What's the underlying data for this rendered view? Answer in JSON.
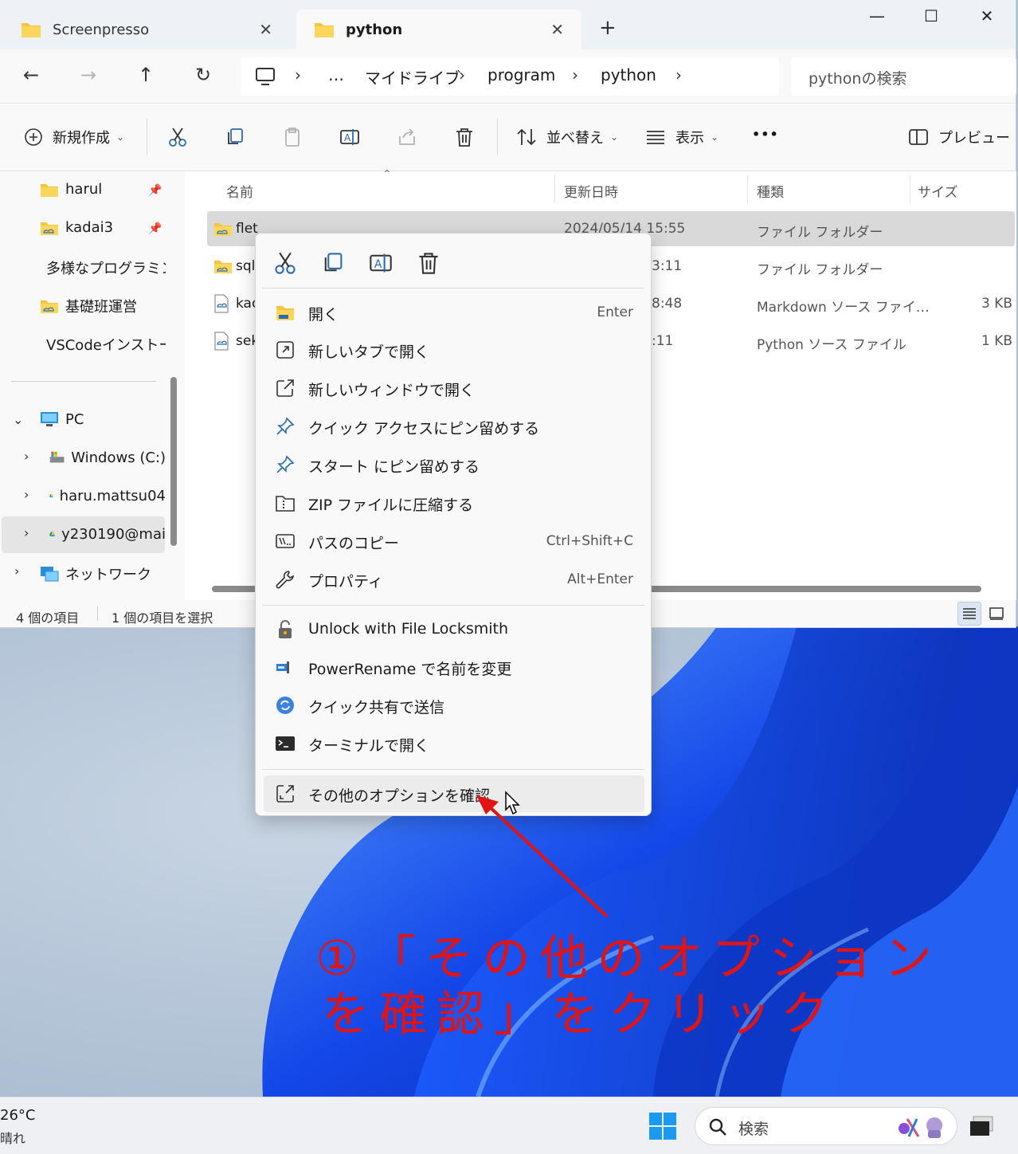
{
  "tabs": [
    {
      "label": "Screenpresso",
      "active": false
    },
    {
      "label": "python",
      "active": true
    }
  ],
  "new_tab": "+",
  "window_controls": {
    "minimize": "—",
    "maximize": "☐",
    "close": "✕"
  },
  "breadcrumb": {
    "overflow": "…",
    "items": [
      "マイドライブ",
      "program",
      "python"
    ]
  },
  "search": {
    "placeholder": "pythonの検索"
  },
  "toolbar": {
    "new_label": "新規作成",
    "sort_label": "並べ替え",
    "view_label": "表示",
    "more_label": "•••",
    "preview_label": "プレビュー"
  },
  "nav": {
    "quick_items": [
      {
        "label": "harul",
        "pinned": true
      },
      {
        "label": "kadai3",
        "pinned": true
      },
      {
        "label": "多様なプログラミン",
        "pinned": false
      },
      {
        "label": "基礎班運営",
        "pinned": false
      },
      {
        "label": "VSCodeインストー",
        "pinned": false
      }
    ],
    "pc_label": "PC",
    "drives": [
      {
        "label": "Windows (C:)",
        "icon": "drive-icon"
      },
      {
        "label": "haru.mattsu04",
        "icon": "google-drive-icon"
      },
      {
        "label": "y230190@mai",
        "icon": "google-drive-icon"
      }
    ],
    "network_label": "ネットワーク"
  },
  "columns": {
    "name": "名前",
    "date": "更新日時",
    "type": "種類",
    "size": "サイズ"
  },
  "files": [
    {
      "name": "flet",
      "date": "2024/05/14 15:55",
      "type": "ファイル フォルダー",
      "size": "",
      "selected": true
    },
    {
      "name": "sql",
      "date": "3:11",
      "type": "ファイル フォルダー",
      "size": "",
      "selected": false
    },
    {
      "name": "kac",
      "date": "8:48",
      "type": "Markdown ソース ファイ…",
      "size": "3 KB",
      "selected": false
    },
    {
      "name": "sek",
      "date": ":11",
      "type": "Python ソース ファイル",
      "size": "1 KB",
      "selected": false
    }
  ],
  "status": {
    "count": "4 個の項目",
    "selected": "1 個の項目を選択"
  },
  "context_menu": {
    "quick_actions": [
      "cut-icon",
      "copy-icon",
      "rename-icon",
      "delete-icon"
    ],
    "group1": [
      {
        "label": "開く",
        "shortcut": "Enter",
        "icon": "folder-open-icon"
      },
      {
        "label": "新しいタブで開く",
        "shortcut": "",
        "icon": "new-tab-icon"
      },
      {
        "label": "新しいウィンドウで開く",
        "shortcut": "",
        "icon": "new-window-icon"
      },
      {
        "label": "クイック アクセスにピン留めする",
        "shortcut": "",
        "icon": "pin-icon"
      },
      {
        "label": "スタート にピン留めする",
        "shortcut": "",
        "icon": "pin-icon"
      },
      {
        "label": "ZIP ファイルに圧縮する",
        "shortcut": "",
        "icon": "zip-icon"
      },
      {
        "label": "パスのコピー",
        "shortcut": "Ctrl+Shift+C",
        "icon": "copy-path-icon"
      },
      {
        "label": "プロパティ",
        "shortcut": "Alt+Enter",
        "icon": "wrench-icon"
      }
    ],
    "group2": [
      {
        "label": "Unlock with File Locksmith",
        "icon": "lock-icon"
      },
      {
        "label": "PowerRename で名前を変更",
        "icon": "powerrename-icon"
      },
      {
        "label": "クイック共有で送信",
        "icon": "share-icon"
      },
      {
        "label": "ターミナルで開く",
        "icon": "terminal-icon"
      }
    ],
    "more_options": {
      "label": "その他のオプションを確認",
      "icon": "more-options-icon"
    }
  },
  "annotation": {
    "line1": "①「その他のオプション",
    "line2": "を確認」をクリック",
    "color": "#e01414"
  },
  "taskbar": {
    "temperature": "26°C",
    "weather": "晴れ",
    "search_label": "検索"
  }
}
